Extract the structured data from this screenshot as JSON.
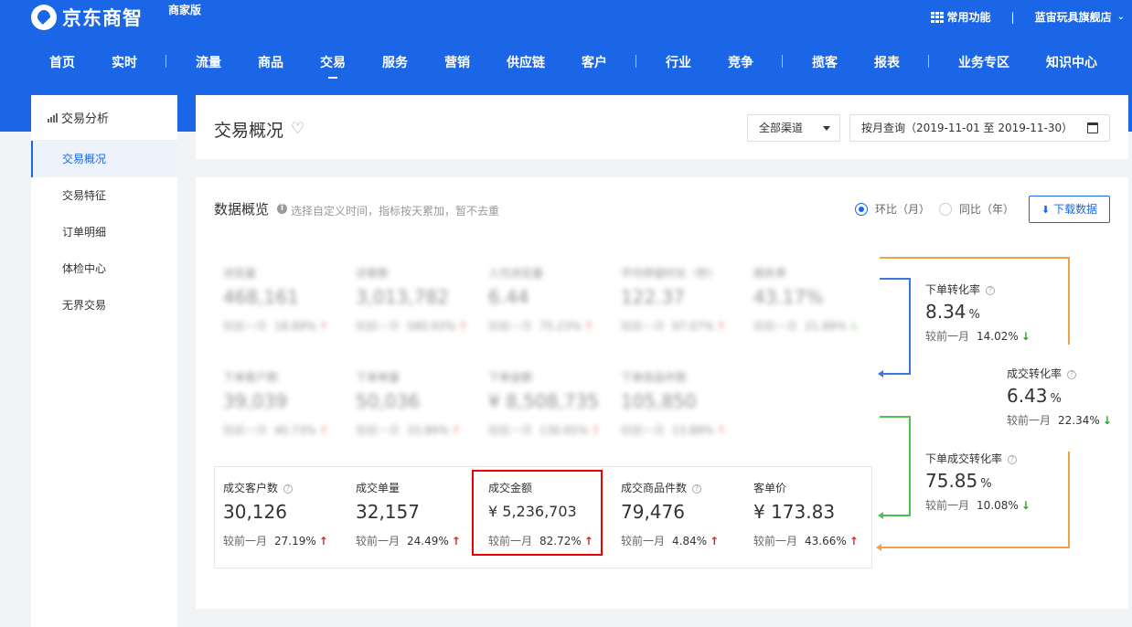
{
  "header": {
    "logo_text": "京东商智",
    "edition": "商家版",
    "common_functions": "常用功能",
    "store_name": "蓝宙玩具旗舰店",
    "nav": [
      {
        "label": "首页"
      },
      {
        "label": "实时"
      },
      {
        "label": "流量"
      },
      {
        "label": "商品"
      },
      {
        "label": "交易",
        "active": true
      },
      {
        "label": "服务"
      },
      {
        "label": "营销"
      },
      {
        "label": "供应链"
      },
      {
        "label": "客户"
      },
      {
        "label": "行业"
      },
      {
        "label": "竞争"
      },
      {
        "label": "揽客"
      },
      {
        "label": "报表"
      },
      {
        "label": "业务专区"
      },
      {
        "label": "知识中心"
      }
    ]
  },
  "sidebar": {
    "heading": "交易分析",
    "items": [
      {
        "label": "交易概况",
        "active": true
      },
      {
        "label": "交易特征"
      },
      {
        "label": "订单明细"
      },
      {
        "label": "体检中心"
      },
      {
        "label": "无界交易"
      }
    ]
  },
  "toolbar": {
    "page_title": "交易概况",
    "channel": "全部渠道",
    "date_range": "按月查询（2019-11-01 至 2019-11-30）"
  },
  "overview": {
    "title": "数据概览",
    "hint": "选择自定义时间，指标按天累加，暂不去重",
    "radio_mom": "环比（月）",
    "radio_yoy": "同比（年）",
    "download": "下载数据",
    "compare_label": "较前一月",
    "blurred_row1": [
      {
        "label": "浏览量",
        "value": "468,161",
        "pct": "18.89%",
        "trend": "up"
      },
      {
        "label": "访客数",
        "value": "3,013,782",
        "pct": "580.93%",
        "trend": "up"
      },
      {
        "label": "人均浏览量",
        "value": "6.44",
        "pct": "75.23%",
        "trend": "up"
      },
      {
        "label": "平均停留时长（秒）",
        "value": "122.37",
        "pct": "97.07%",
        "trend": "up"
      },
      {
        "label": "跳失率",
        "value": "43.17",
        "unit": "%",
        "pct": "21.89%",
        "trend": "down"
      }
    ],
    "blurred_row2": [
      {
        "label": "下单客户数",
        "value": "39,039",
        "pct": "40.73%",
        "trend": "up"
      },
      {
        "label": "下单单量",
        "value": "50,036",
        "pct": "33.89%",
        "trend": "up"
      },
      {
        "label": "下单金额",
        "value": "¥ 8,508,735",
        "pct": "130.65%",
        "trend": "up"
      },
      {
        "label": "下单商品件数",
        "value": "105,850",
        "pct": "13.88%",
        "trend": "up"
      }
    ],
    "bottom_row": [
      {
        "label": "成交客户数",
        "value": "30,126",
        "pct": "27.19%",
        "trend": "up",
        "has_help": true
      },
      {
        "label": "成交单量",
        "value": "32,157",
        "pct": "24.49%",
        "trend": "up",
        "has_help": false
      },
      {
        "label": "成交金额",
        "value": "¥ 5,236,703",
        "pct": "82.72%",
        "trend": "up",
        "has_help": false
      },
      {
        "label": "成交商品件数",
        "value": "79,476",
        "pct": "4.84%",
        "trend": "up",
        "has_help": true
      },
      {
        "label": "客单价",
        "value": "¥ 173.83",
        "pct": "43.66%",
        "trend": "up",
        "has_help": false
      }
    ],
    "funnel": [
      {
        "label": "下单转化率",
        "value": "8.34",
        "unit": "%",
        "pct": "14.02%",
        "trend": "down"
      },
      {
        "label": "成交转化率",
        "value": "6.43",
        "unit": "%",
        "pct": "22.34%",
        "trend": "down"
      },
      {
        "label": "下单成交转化率",
        "value": "75.85",
        "unit": "%",
        "pct": "10.08%",
        "trend": "down"
      }
    ],
    "colors": {
      "brand": "#1a66e6",
      "up": "#e62222",
      "down": "#26a826",
      "orange": "#f0a04b",
      "green": "#4fc14f",
      "blue": "#3a78d9"
    }
  }
}
